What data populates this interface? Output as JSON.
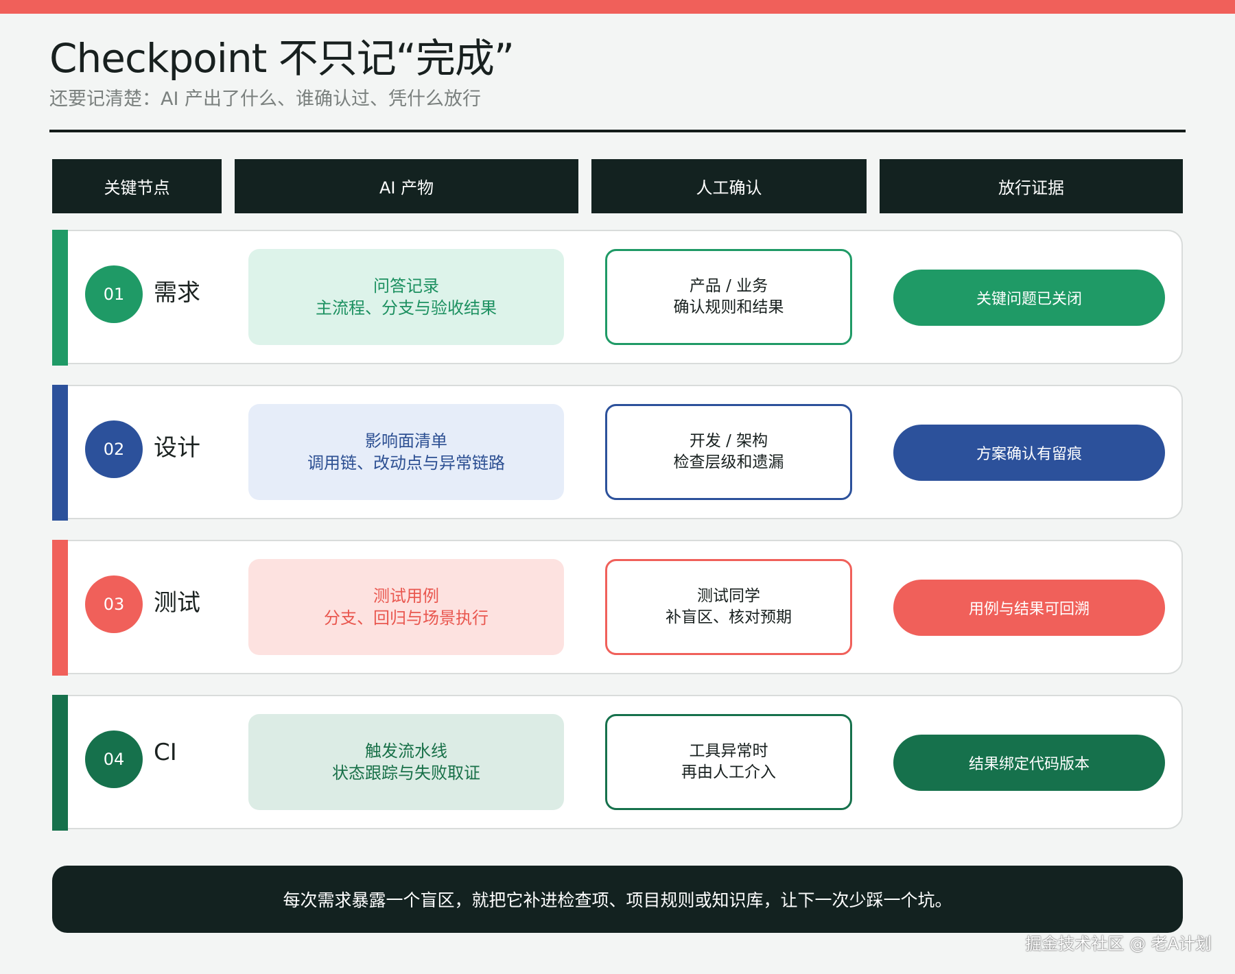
{
  "title": "Checkpoint 不只记“完成”",
  "subtitle": "还要记清楚：AI 产出了什么、谁确认过、凭什么放行",
  "headers": [
    "关键节点",
    "AI 产物",
    "人工确认",
    "放行证据"
  ],
  "rows": [
    {
      "num": "01",
      "stage": "需求",
      "ai_line1": "问答记录",
      "ai_line2": "主流程、分支与验收结果",
      "human_line1": "产品 / 业务",
      "human_line2": "确认规则和结果",
      "evidence": "关键问题已关闭",
      "color": "#1f9a66",
      "ai_bg": "#ddf3ea",
      "ai_text": "#1c9060"
    },
    {
      "num": "02",
      "stage": "设计",
      "ai_line1": "影响面清单",
      "ai_line2": "调用链、改动点与异常链路",
      "human_line1": "开发 / 架构",
      "human_line2": "检查层级和遗漏",
      "evidence": "方案确认有留痕",
      "color": "#2c519b",
      "ai_bg": "#e6edf9",
      "ai_text": "#2c4f92"
    },
    {
      "num": "03",
      "stage": "测试",
      "ai_line1": "测试用例",
      "ai_line2": "分支、回归与场景执行",
      "human_line1": "测试同学",
      "human_line2": "补盲区、核对预期",
      "evidence": "用例与结果可回溯",
      "color": "#f0605a",
      "ai_bg": "#fde2e0",
      "ai_text": "#e9574f"
    },
    {
      "num": "04",
      "stage": "CI",
      "ai_line1": "触发流水线",
      "ai_line2": "状态跟踪与失败取证",
      "human_line1": "工具异常时",
      "human_line2": "再由人工介入",
      "evidence": "结果绑定代码版本",
      "color": "#16714c",
      "ai_bg": "#dcece5",
      "ai_text": "#187048"
    }
  ],
  "footer": "每次需求暴露一个盲区，就把它补进检查项、项目规则或知识库，让下一次少踩一个坑。",
  "watermark": "掘金技术社区 @ 老A计划",
  "colors": {
    "top_bar": "#f0605a",
    "dark": "#132220"
  }
}
